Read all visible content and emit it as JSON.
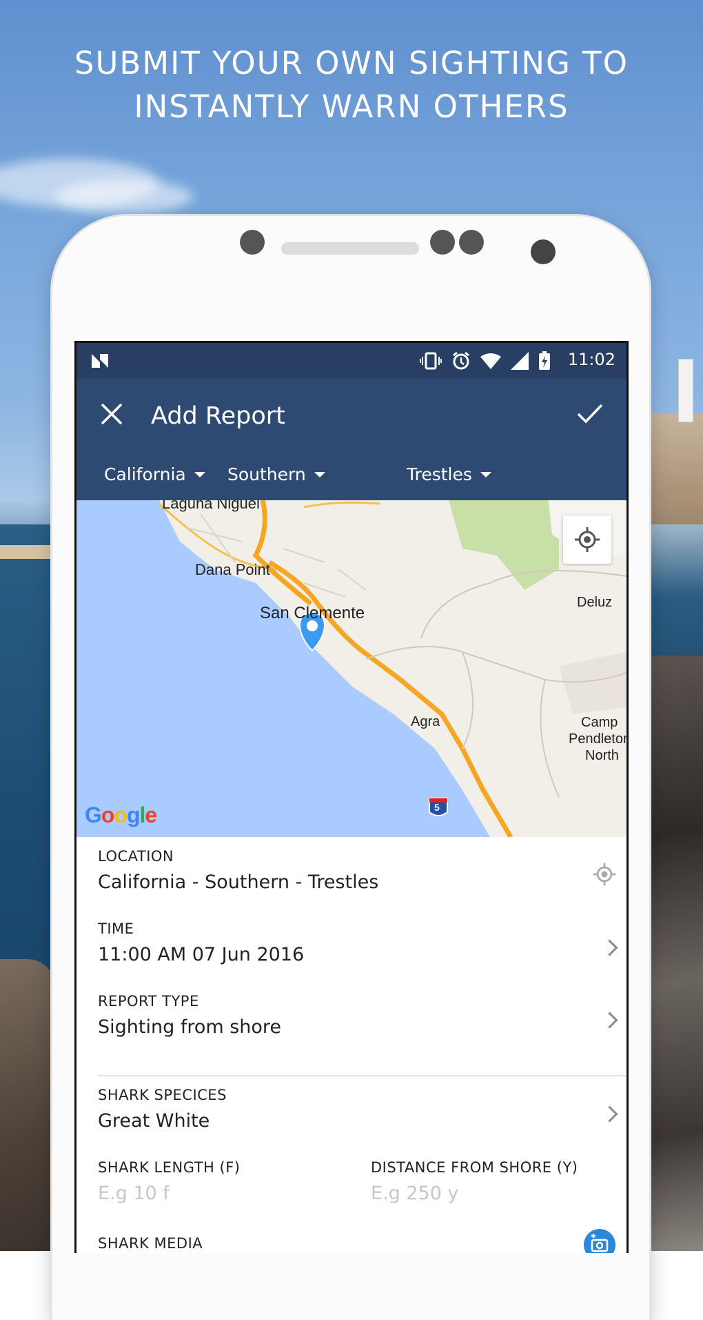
{
  "headline": {
    "line1": "SUBMIT YOUR OWN SIGHTING TO",
    "line2": "INSTANTLY WARN OTHERS"
  },
  "status_bar": {
    "time": "11:02",
    "icons": [
      "n-notification-icon",
      "vibrate-icon",
      "alarm-icon",
      "wifi-icon",
      "signal-icon",
      "battery-charging-icon"
    ]
  },
  "app_bar": {
    "title": "Add Report",
    "close_icon": "close-icon",
    "confirm_icon": "check-icon"
  },
  "filters": {
    "state": "California",
    "region": "Southern",
    "spot": "Trestles"
  },
  "map": {
    "labels": {
      "laguna": "Laguna Niguel",
      "dana": "Dana Point",
      "clemente": "San Clemente",
      "deluz": "Deluz",
      "agra": "Agra",
      "camp1": "Camp",
      "camp2": "Pendleton",
      "camp3": "North",
      "route": "5"
    },
    "attribution": "Google",
    "colors": {
      "water": "#aacbff",
      "land": "#f2efe9",
      "park": "#c8dfa8",
      "highway": "#f5a623",
      "pin": "#3b9bf0"
    }
  },
  "form": {
    "location": {
      "label": "LOCATION",
      "value": "California - Southern - Trestles"
    },
    "time": {
      "label": "TIME",
      "value": "11:00 AM 07 Jun 2016"
    },
    "report_type": {
      "label": "REPORT TYPE",
      "value": "Sighting from shore"
    },
    "species": {
      "label": "SHARK SPECICES",
      "value": "Great White"
    },
    "length": {
      "label": "SHARK LENGTH (F)",
      "placeholder": "E.g 10 f"
    },
    "distance": {
      "label": "DISTANCE FROM SHORE (Y)",
      "placeholder": "E.g 250 y"
    },
    "media": {
      "label": "SHARK MEDIA"
    }
  }
}
